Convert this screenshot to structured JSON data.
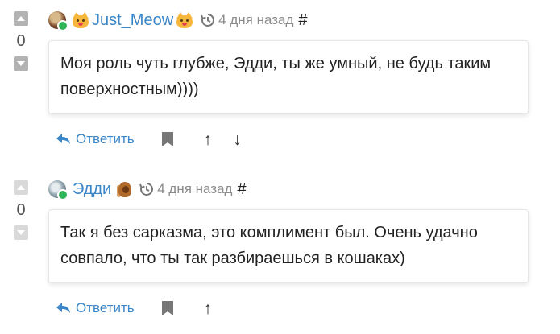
{
  "comments": [
    {
      "author": "Just_Meow",
      "time": "4 дня назад",
      "hash": "#",
      "score": "0",
      "text": "Моя роль чуть глубже, Эдди, ты же умный, не будь таким поверхностным))))",
      "reply_label": "Ответить",
      "arrow_up": "↑",
      "arrow_down": "↓"
    },
    {
      "author": "Эдди",
      "time": "4 дня назад",
      "hash": "#",
      "score": "0",
      "text": "Так я без сарказма, это комплимент был. Очень удачно совпало, что ты так разбираешься в кошаках)",
      "reply_label": "Ответить",
      "arrow_up": "↑"
    }
  ],
  "colors": {
    "link": "#3a86c8",
    "online": "#2fb457",
    "muted": "#8a8a8a"
  },
  "icons": [
    "caret-up-icon",
    "caret-down-icon",
    "cat-emoji-icon",
    "clock-history-icon",
    "reply-arrow-icon",
    "bookmark-icon"
  ]
}
